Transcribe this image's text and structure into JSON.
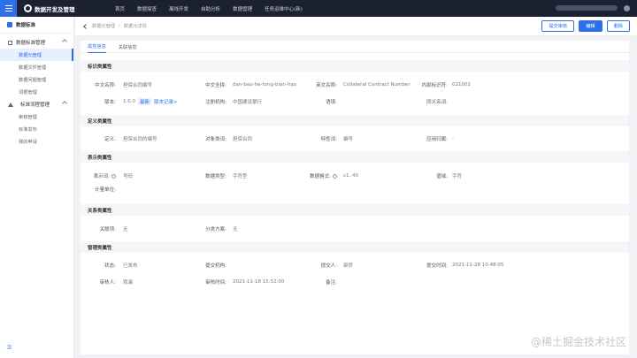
{
  "topbar": {
    "logo": "数据开发及管理",
    "nav": [
      "首页",
      "数据探查",
      "离线开发",
      "自助分析",
      "数据管理",
      "任务运维中心(新)"
    ]
  },
  "sidebar": {
    "title": "数据标准",
    "groups": [
      {
        "label": "数据标准管理",
        "items": [
          "数据元管理",
          "数据文件管理",
          "数据问题管理",
          "词根管理"
        ]
      },
      {
        "label": "标准流程管理",
        "items": [
          "审核管理",
          "标准发布",
          "我的申请"
        ]
      }
    ],
    "foot": "☰"
  },
  "header": {
    "breadcrumb": [
      "数据元管理",
      "数据元详情"
    ],
    "buttons": {
      "submit": "提交审核",
      "edit": "编辑",
      "delete": "删除"
    }
  },
  "tabs": [
    "属性信息",
    "关联信息"
  ],
  "sections": {
    "identity": "标识类属性",
    "definition": "定义类属性",
    "representation": "表示类属性",
    "relation": "关系类属性",
    "management": "管理类属性"
  },
  "fields": {
    "cn_name": {
      "label": "中文名称:",
      "value": "担保合同编号"
    },
    "cn_pinyin": {
      "label": "中文全拼:",
      "value": "dan-bao-he-tong-bian-hao"
    },
    "en_name": {
      "label": "英文名称:",
      "value": "Collateral Contract Number"
    },
    "inner_id": {
      "label": "内部标识符:",
      "value": "021002"
    },
    "version": {
      "label": "版本:",
      "value": "1.0.0",
      "tag": "最新",
      "link": "版本记录>"
    },
    "reg_org": {
      "label": "注册机构:",
      "value": "中国建设银行"
    },
    "context": {
      "label": "语境:",
      "value": ""
    },
    "synonym": {
      "label": "同义名词:",
      "value": ""
    },
    "definition": {
      "label": "定义:",
      "value": "担保合同的编号"
    },
    "obj_class": {
      "label": "对象类词:",
      "value": "担保合同"
    },
    "feature": {
      "label": "特性词:",
      "value": "编号"
    },
    "source": {
      "label": "应用归属:",
      "value": "-"
    },
    "repr_word": {
      "label": "表示词:",
      "value": "号码"
    },
    "data_type": {
      "label": "数据类型:",
      "value": "字符型"
    },
    "data_format": {
      "label": "数据格式:",
      "value": "c1..40"
    },
    "value_domain": {
      "label": "值域:",
      "value": "字符"
    },
    "unit": {
      "label": "计量单位:",
      "value": ""
    },
    "relation": {
      "label": "关联项:",
      "value": "无"
    },
    "class_scheme": {
      "label": "分类方案:",
      "value": "无"
    },
    "status": {
      "label": "状态:",
      "value": "已发布"
    },
    "submit_org": {
      "label": "提交机构:",
      "value": ""
    },
    "submitter": {
      "label": "提交人:",
      "value": "部侨"
    },
    "submit_time": {
      "label": "提交时间:",
      "value": "2021-11-28 10:48:05"
    },
    "reviewer": {
      "label": "审核人:",
      "value": "观澜"
    },
    "review_time": {
      "label": "审核时间:",
      "value": "2021-11-18 15:52:00"
    },
    "remark": {
      "label": "备注:",
      "value": ""
    }
  },
  "watermark": "@稀土掘金技术社区"
}
